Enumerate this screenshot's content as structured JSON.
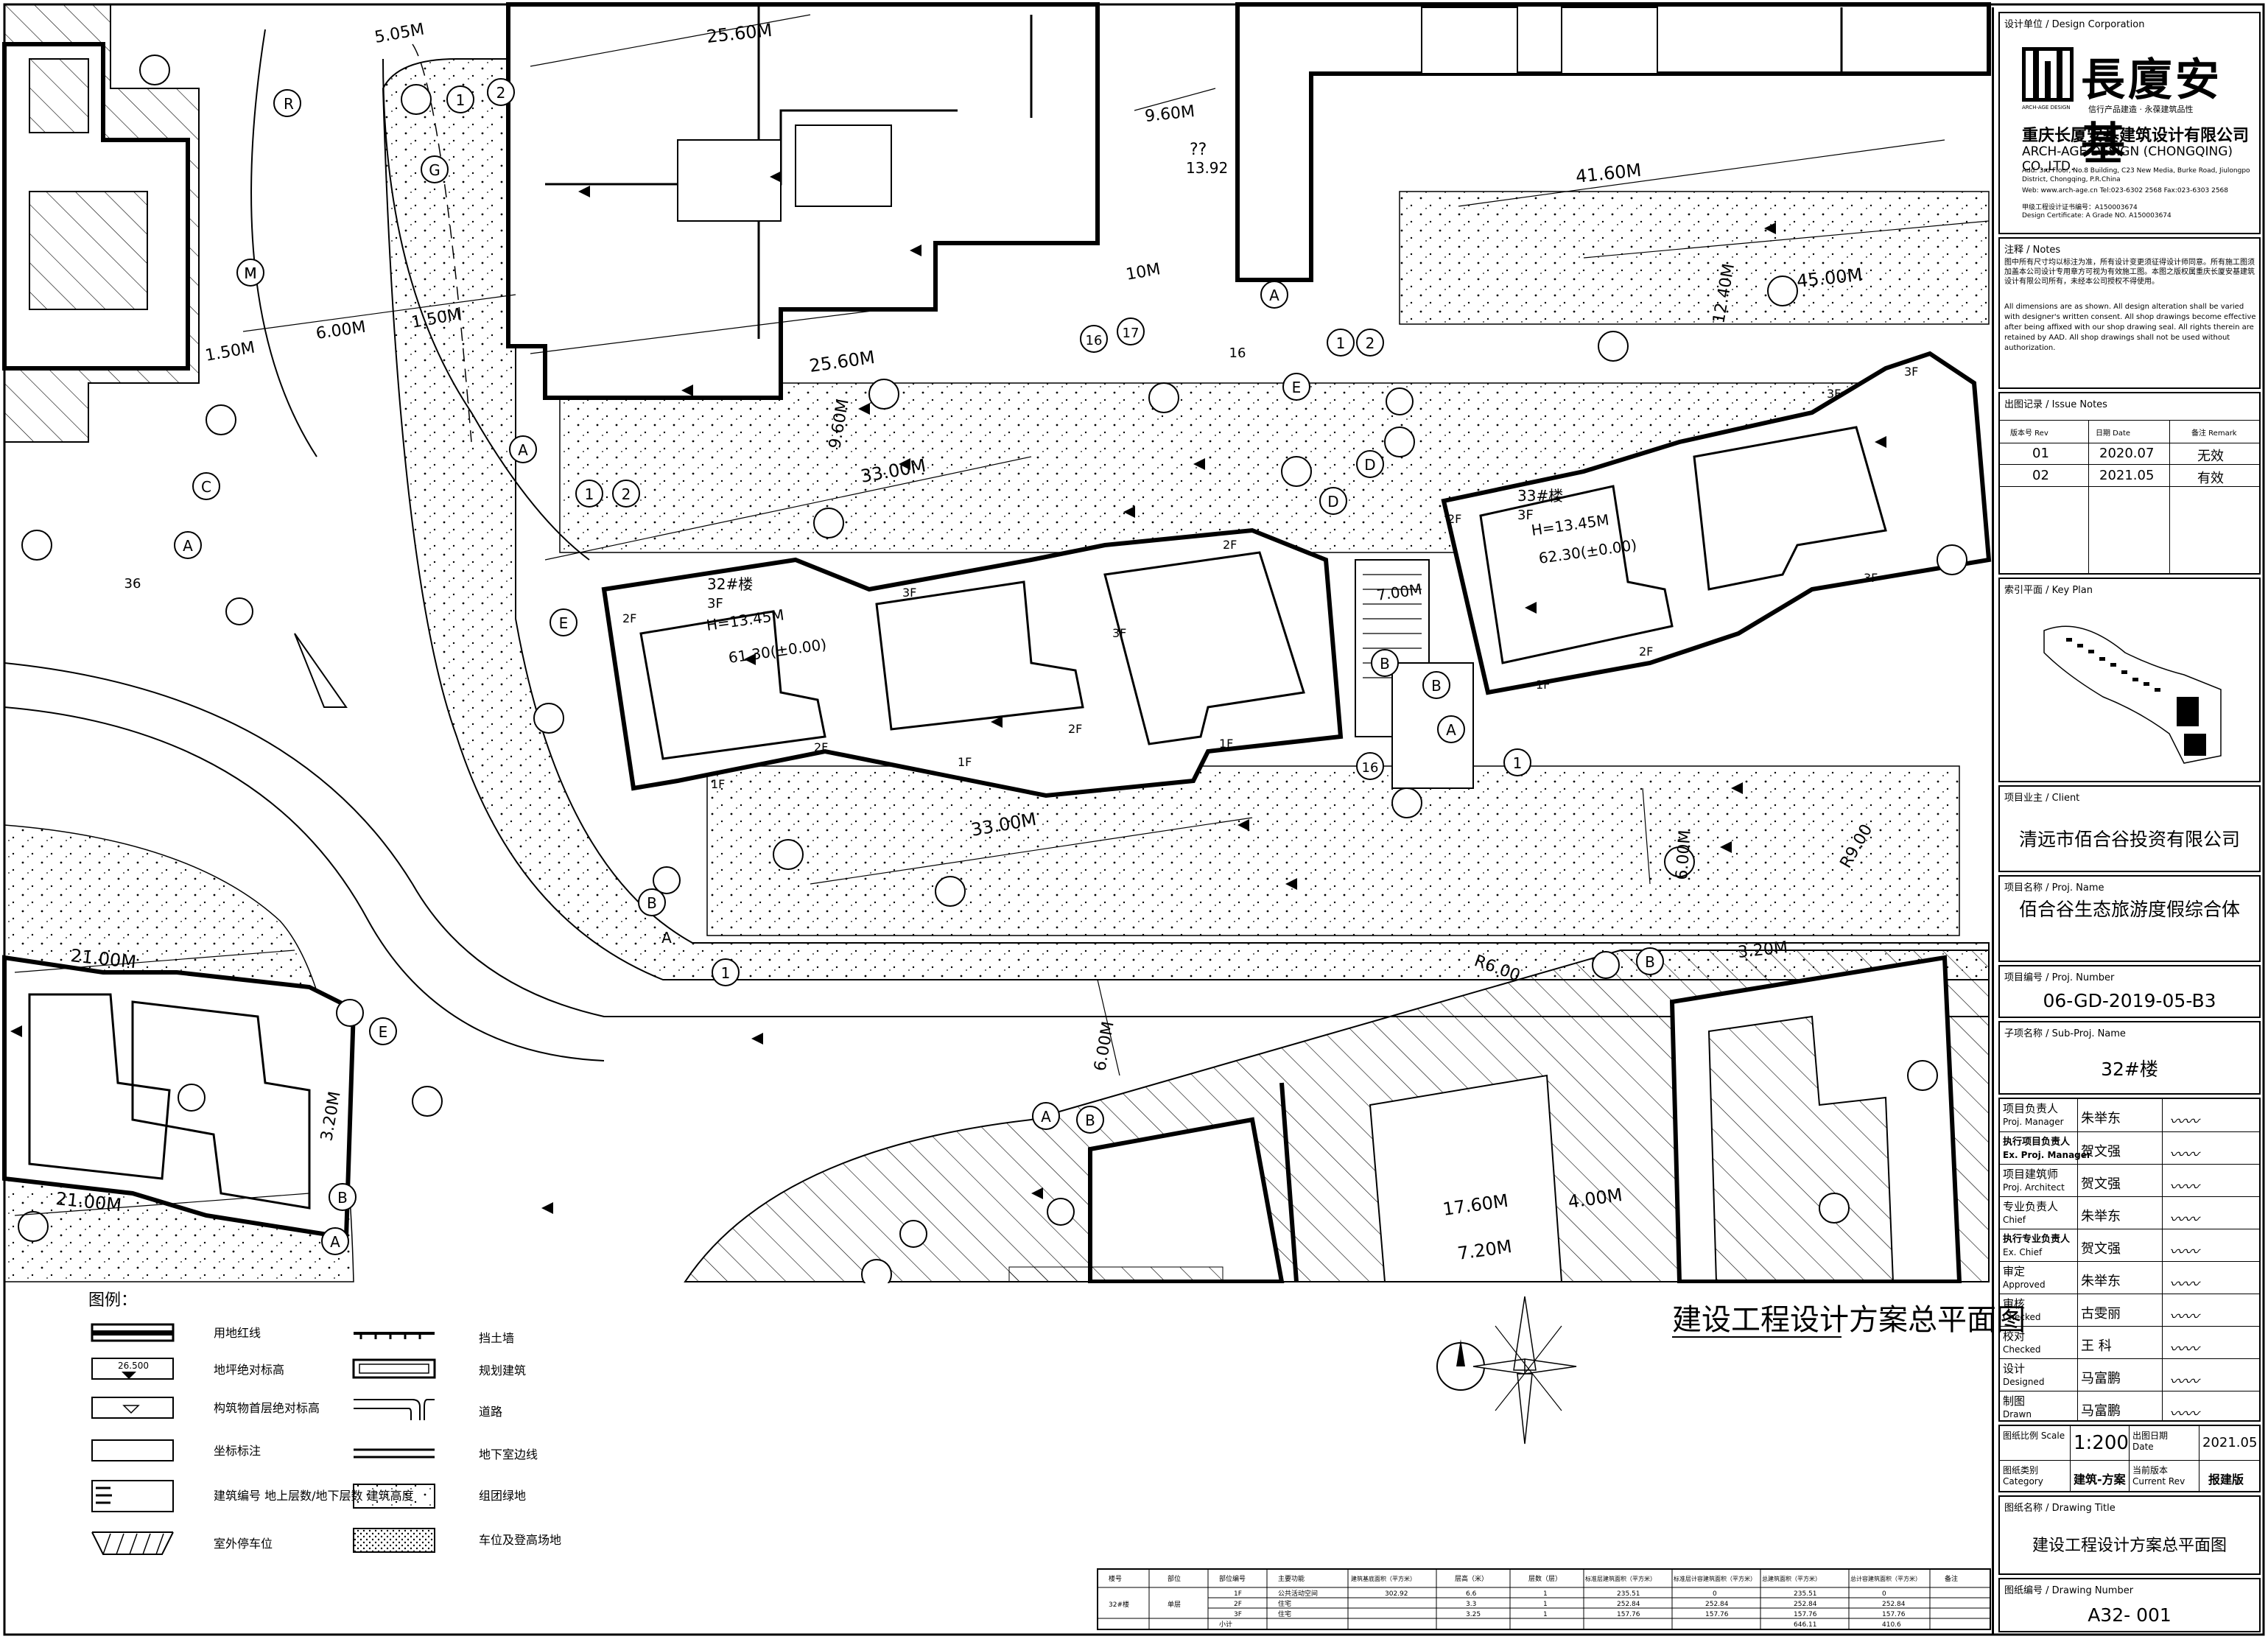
{
  "drawing": {
    "title": "建设工程设计方案总平面图",
    "buildings": [
      {
        "id": "32#楼",
        "height": "H=13.45M",
        "elev": "61.30(±0.00)",
        "floors": "3F"
      },
      {
        "id": "33#楼",
        "height": "H=13.45M",
        "elev": "62.30(±0.00)",
        "floors": "3F"
      }
    ],
    "floor_labels": [
      "1F",
      "2F",
      "3F"
    ],
    "dims": [
      "25.60M",
      "25.60M",
      "33.00M",
      "33.00M",
      "21.00M",
      "21.00M",
      "41.60M",
      "45.00M",
      "12.40M",
      "9.60M",
      "9.60M",
      "6.00M",
      "6.00M",
      "6.00M",
      "1.50M",
      "1.50M",
      "5.05M",
      "7.00M",
      "17.60M",
      "7.20M",
      "4.00M",
      "3.20M",
      "3.20M",
      "R6.00",
      "R9.00",
      "10M",
      "13.92",
      "??"
    ],
    "axis_letters": [
      "A",
      "B",
      "C",
      "D",
      "E",
      "G",
      "M",
      "R"
    ],
    "axis_numbers": [
      "1",
      "2",
      "16",
      "17",
      "36"
    ]
  },
  "legend": {
    "title": "图例：",
    "items_left": [
      "用地红线",
      "地坪绝对标高",
      "构筑物首层绝对标高",
      "坐标标注",
      "建筑编号 地上层数/地下层数 建筑高度",
      "室外停车位"
    ],
    "items_right": [
      "挡土墙",
      "规划建筑",
      "道路",
      "地下室边线",
      "组团绿地",
      "车位及登高场地"
    ],
    "elev_sample": "26.500"
  },
  "area_table": {
    "headers": [
      "楼号",
      "部位",
      "部位编号",
      "主要功能",
      "建筑基底面积（平方米）",
      "层高（米）",
      "层数（层）",
      "标准层建筑面积（平方米）",
      "标准层计容建筑面积（平方米）",
      "总建筑面积（平方米）",
      "总计容建筑面积（平方米）",
      "备注"
    ],
    "building": "32#楼",
    "part": "单层",
    "rows": [
      [
        "1F",
        "公共活动空间",
        "302.92",
        "6.6",
        "1",
        "235.51",
        "0",
        "235.51",
        "0"
      ],
      [
        "2F",
        "住宅",
        "",
        "3.3",
        "1",
        "252.84",
        "252.84",
        "252.84",
        "252.84"
      ],
      [
        "3F",
        "住宅",
        "",
        "3.25",
        "1",
        "157.76",
        "157.76",
        "157.76",
        "157.76"
      ]
    ],
    "subtotal_label": "小计",
    "subtotal": [
      "646.11",
      "410.6"
    ]
  },
  "title_block": {
    "design_unit_label": "设计单位 / Design Corporation",
    "logo_text": "長廈安基",
    "logo_mono": "ARCH-AGE DESIGN",
    "slogan": "信行产品建造 · 永葆建筑品性",
    "company_cn": "重庆长厦安基建筑设计有限公司",
    "company_en": "ARCH-AGE DESIGN (CHONGQING) CO.,LTD.",
    "address": "Add: 3rd Floor, No.8 Building, C23 New Media, Burke Road, Jiulongpo District, Chongqing, P.R.China",
    "website": "Web: www.arch-age.cn  Tel:023-6302 2568  Fax:023-6303 2568",
    "cert": "甲级工程设计证书编号：A150003674",
    "cert_en": "Design Certificate: A Grade NO. A150003674",
    "notes_label": "注释 / Notes",
    "notes_cn": "图中所有尺寸均以标注为准，所有设计变更须征得设计师同意。所有施工图须加盖本公司设计专用章方可视为有效施工图。本图之版权属重庆长厦安基建筑设计有限公司所有，未经本公司授权不得使用。",
    "notes_en": "All dimensions are as shown. All design alteration shall be varied with designer's written consent. All shop drawings become effective after being affixed with our shop drawing seal. All rights therein are retained by AAD. All shop drawings shall not be used without authorization.",
    "issue_label": "出图记录 / Issue Notes",
    "issue_headers": [
      "版本号 Rev",
      "日期 Date",
      "备注 Remark"
    ],
    "issues": [
      {
        "rev": "01",
        "date": "2020.07",
        "remark": "无效"
      },
      {
        "rev": "02",
        "date": "2021.05",
        "remark": "有效"
      }
    ],
    "key_plan_label": "索引平面 / Key Plan",
    "client_label": "项目业主 / Client",
    "client": "清远市佰合谷投资有限公司",
    "proj_name_label": "项目名称 / Proj. Name",
    "proj_name": "佰合谷生态旅游度假综合体",
    "proj_number_label": "项目编号 / Proj. Number",
    "proj_number": "06-GD-2019-05-B3",
    "sub_proj_label": "子项名称 / Sub-Proj. Name",
    "sub_proj": "32#楼",
    "signatures": [
      {
        "role_cn": "项目负责人",
        "role_en": "Proj. Manager",
        "name": "朱举东"
      },
      {
        "role_cn": "执行项目负责人",
        "role_en": "Ex. Proj. Manager",
        "name": "贺文强"
      },
      {
        "role_cn": "项目建筑师",
        "role_en": "Proj. Architect",
        "name": "贺文强"
      },
      {
        "role_cn": "专业负责人",
        "role_en": "Chief",
        "name": "朱举东"
      },
      {
        "role_cn": "执行专业负责人",
        "role_en": "Ex. Chief",
        "name": "贺文强"
      },
      {
        "role_cn": "审定",
        "role_en": "Approved",
        "name": "朱举东"
      },
      {
        "role_cn": "审核",
        "role_en": "Checked",
        "name": "古雯丽"
      },
      {
        "role_cn": "校对",
        "role_en": "Checked",
        "name": "王 科"
      },
      {
        "role_cn": "设计",
        "role_en": "Designed",
        "name": "马富鹏"
      },
      {
        "role_cn": "制图",
        "role_en": "Drawn",
        "name": "马富鹏"
      }
    ],
    "scale_label": "图纸比例 Scale",
    "scale": "1:200",
    "date_label": "出图日期 Date",
    "date": "2021.05",
    "category_label": "图纸类别 Category",
    "category": "建筑-方案",
    "current_rev_label": "当前版本 Current Rev",
    "current_rev": "报建版",
    "drawing_title_label": "图纸名称 / Drawing Title",
    "drawing_title": "建设工程设计方案总平面图",
    "drawing_number_label": "图纸编号 / Drawing Number",
    "drawing_number": "A32- 001"
  }
}
